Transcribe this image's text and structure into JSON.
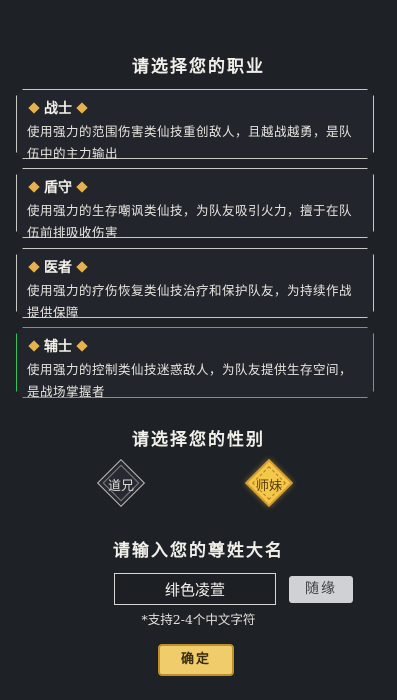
{
  "profession": {
    "title": "请选择您的职业",
    "cards": [
      {
        "name": "战士",
        "desc": "使用强力的范围伤害类仙技重创敌人，且越战越勇，是队伍中的主力输出"
      },
      {
        "name": "盾守",
        "desc": "使用强力的生存嘲讽类仙技，为队友吸引火力，擅于在队伍前排吸收伤害"
      },
      {
        "name": "医者",
        "desc": "使用强力的疗伤恢复类仙技治疗和保护队友，为持续作战提供保障"
      },
      {
        "name": "辅士",
        "desc": "使用强力的控制类仙技迷惑敌人，为队友提供生存空间，是战场掌握者",
        "selected": true
      }
    ]
  },
  "gender": {
    "title": "请选择您的性别",
    "male": "道兄",
    "female": "师妹",
    "selected": "female"
  },
  "name": {
    "title": "请输入您的尊姓大名",
    "value": "绯色凌萱",
    "random_label": "随缘",
    "hint": "*支持2-4个中文字符"
  },
  "confirm_label": "确定",
  "colors": {
    "selected_border": "#37c159",
    "accent": "#e7b24b",
    "background": "#1e2126"
  }
}
